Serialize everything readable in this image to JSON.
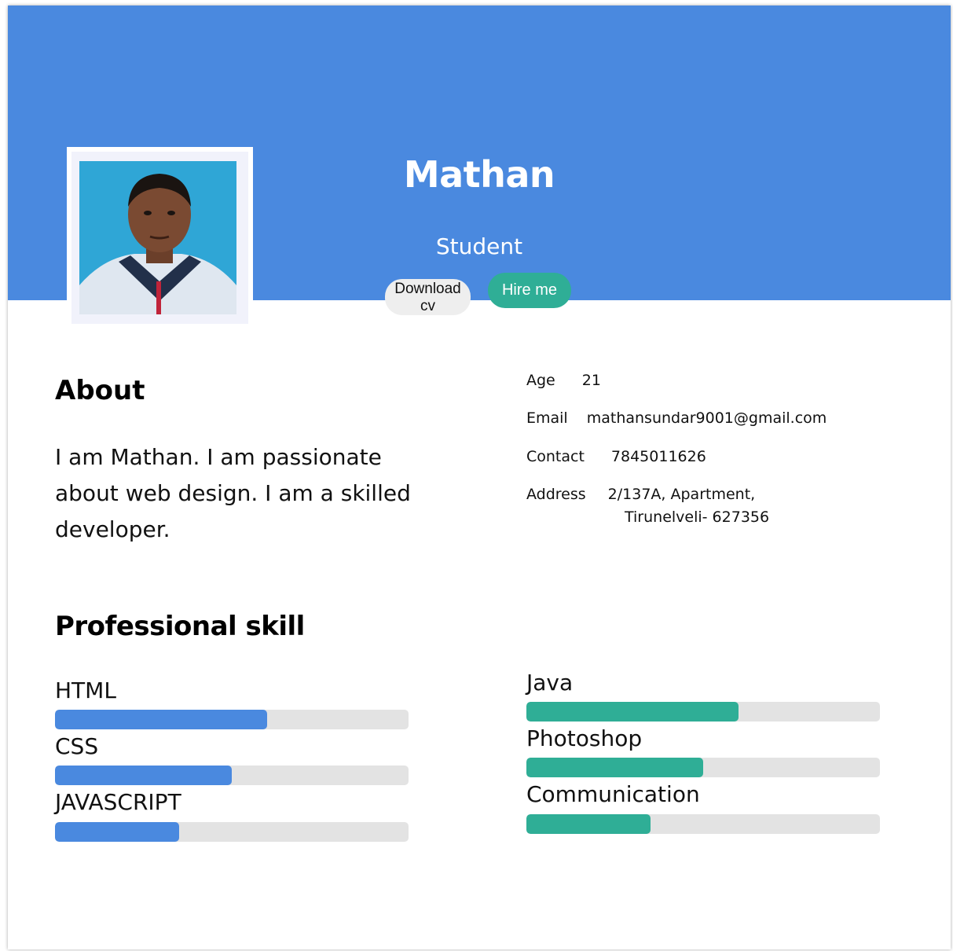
{
  "profile": {
    "name": "Mathan",
    "role": "Student",
    "download_label_line1": "Download",
    "download_label_line2": "cv",
    "hire_label": "Hire me"
  },
  "about": {
    "title": "About",
    "text": "I am Mathan. I am passionate about web design. I am a skilled developer."
  },
  "info": {
    "age_label": "Age",
    "age_value": "21",
    "email_label": "Email",
    "email_value": "mathansundar9001@gmail.com",
    "contact_label": "Contact",
    "contact_value": "7845011626",
    "address_label": "Address",
    "address_line1": "2/137A, Apartment,",
    "address_line2": "Tirunelveli- 627356"
  },
  "skills": {
    "title": "Professional skill",
    "left": [
      {
        "label": "HTML",
        "level": 0.6
      },
      {
        "label": "CSS",
        "level": 0.5
      },
      {
        "label": "JAVASCRIPT",
        "level": 0.35
      }
    ],
    "right": [
      {
        "label": "Java",
        "level": 0.6
      },
      {
        "label": "Photoshop",
        "level": 0.5
      },
      {
        "label": "Communication",
        "level": 0.35
      }
    ]
  },
  "colors": {
    "banner": "#4a89df",
    "accent_green": "#2fae96",
    "bar_track": "#e3e3e3"
  }
}
